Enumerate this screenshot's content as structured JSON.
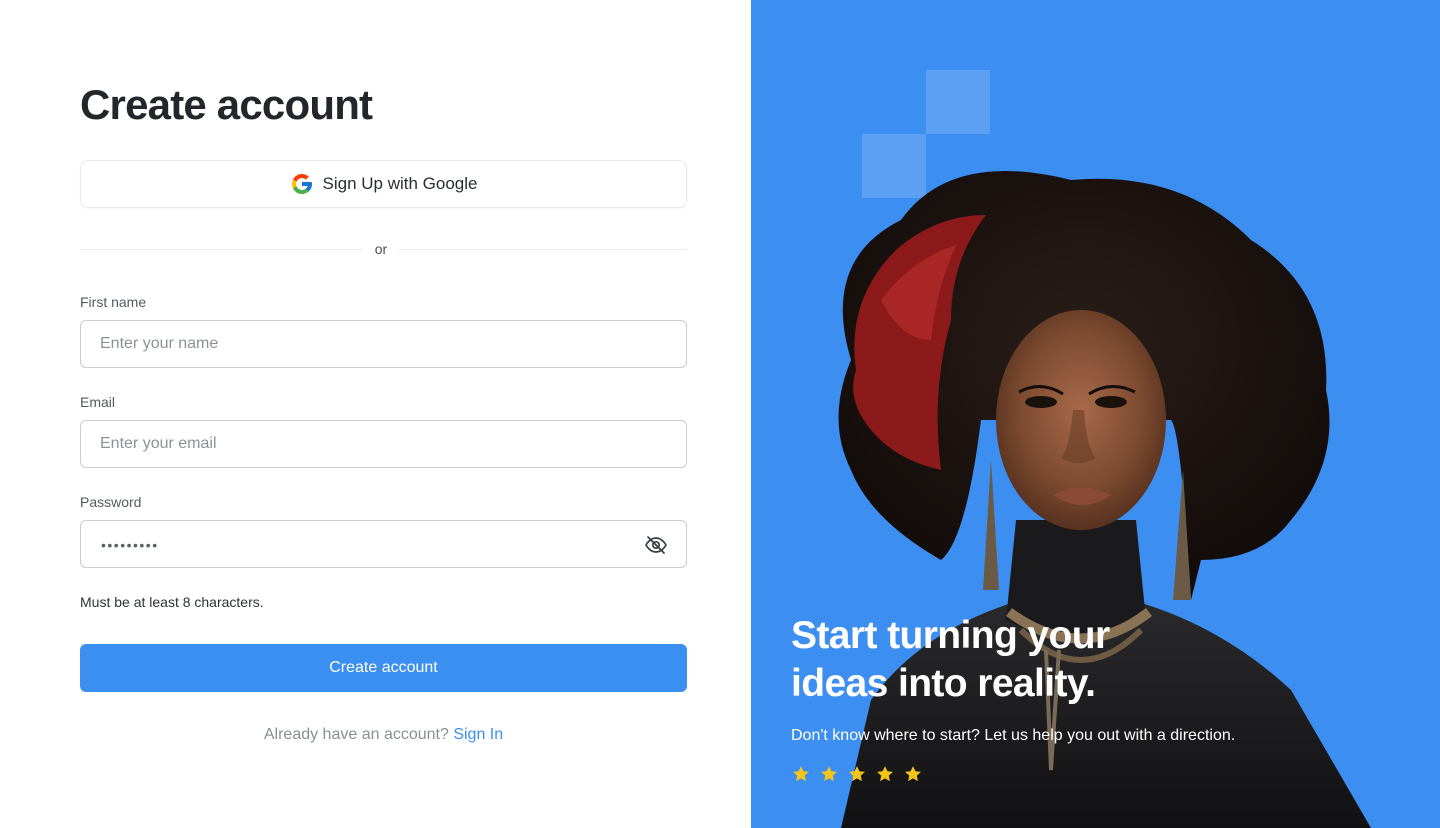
{
  "form": {
    "title": "Create account",
    "google_button_label": "Sign Up with Google",
    "divider_text": "or",
    "first_name": {
      "label": "First name",
      "placeholder": "Enter your name",
      "value": ""
    },
    "email": {
      "label": "Email",
      "placeholder": "Enter your email",
      "value": ""
    },
    "password": {
      "label": "Password",
      "masked_value": "•••••••••",
      "toggle_icon": "eye-off-icon"
    },
    "password_hint": "Must be at least 8 characters.",
    "submit_label": "Create account",
    "signin_prompt": "Already have an account?",
    "signin_link": "Sign In"
  },
  "hero": {
    "title_line1": "Start turning your",
    "title_line2": "ideas into reality.",
    "subtitle": "Don't know where to start? Let us help you out with a direction.",
    "rating": 5,
    "rating_icon": "star-icon"
  },
  "colors": {
    "primary": "#3b8ff0",
    "hero_background": "#3d8ef1",
    "star": "#f5c518",
    "title_text": "#23272b"
  }
}
